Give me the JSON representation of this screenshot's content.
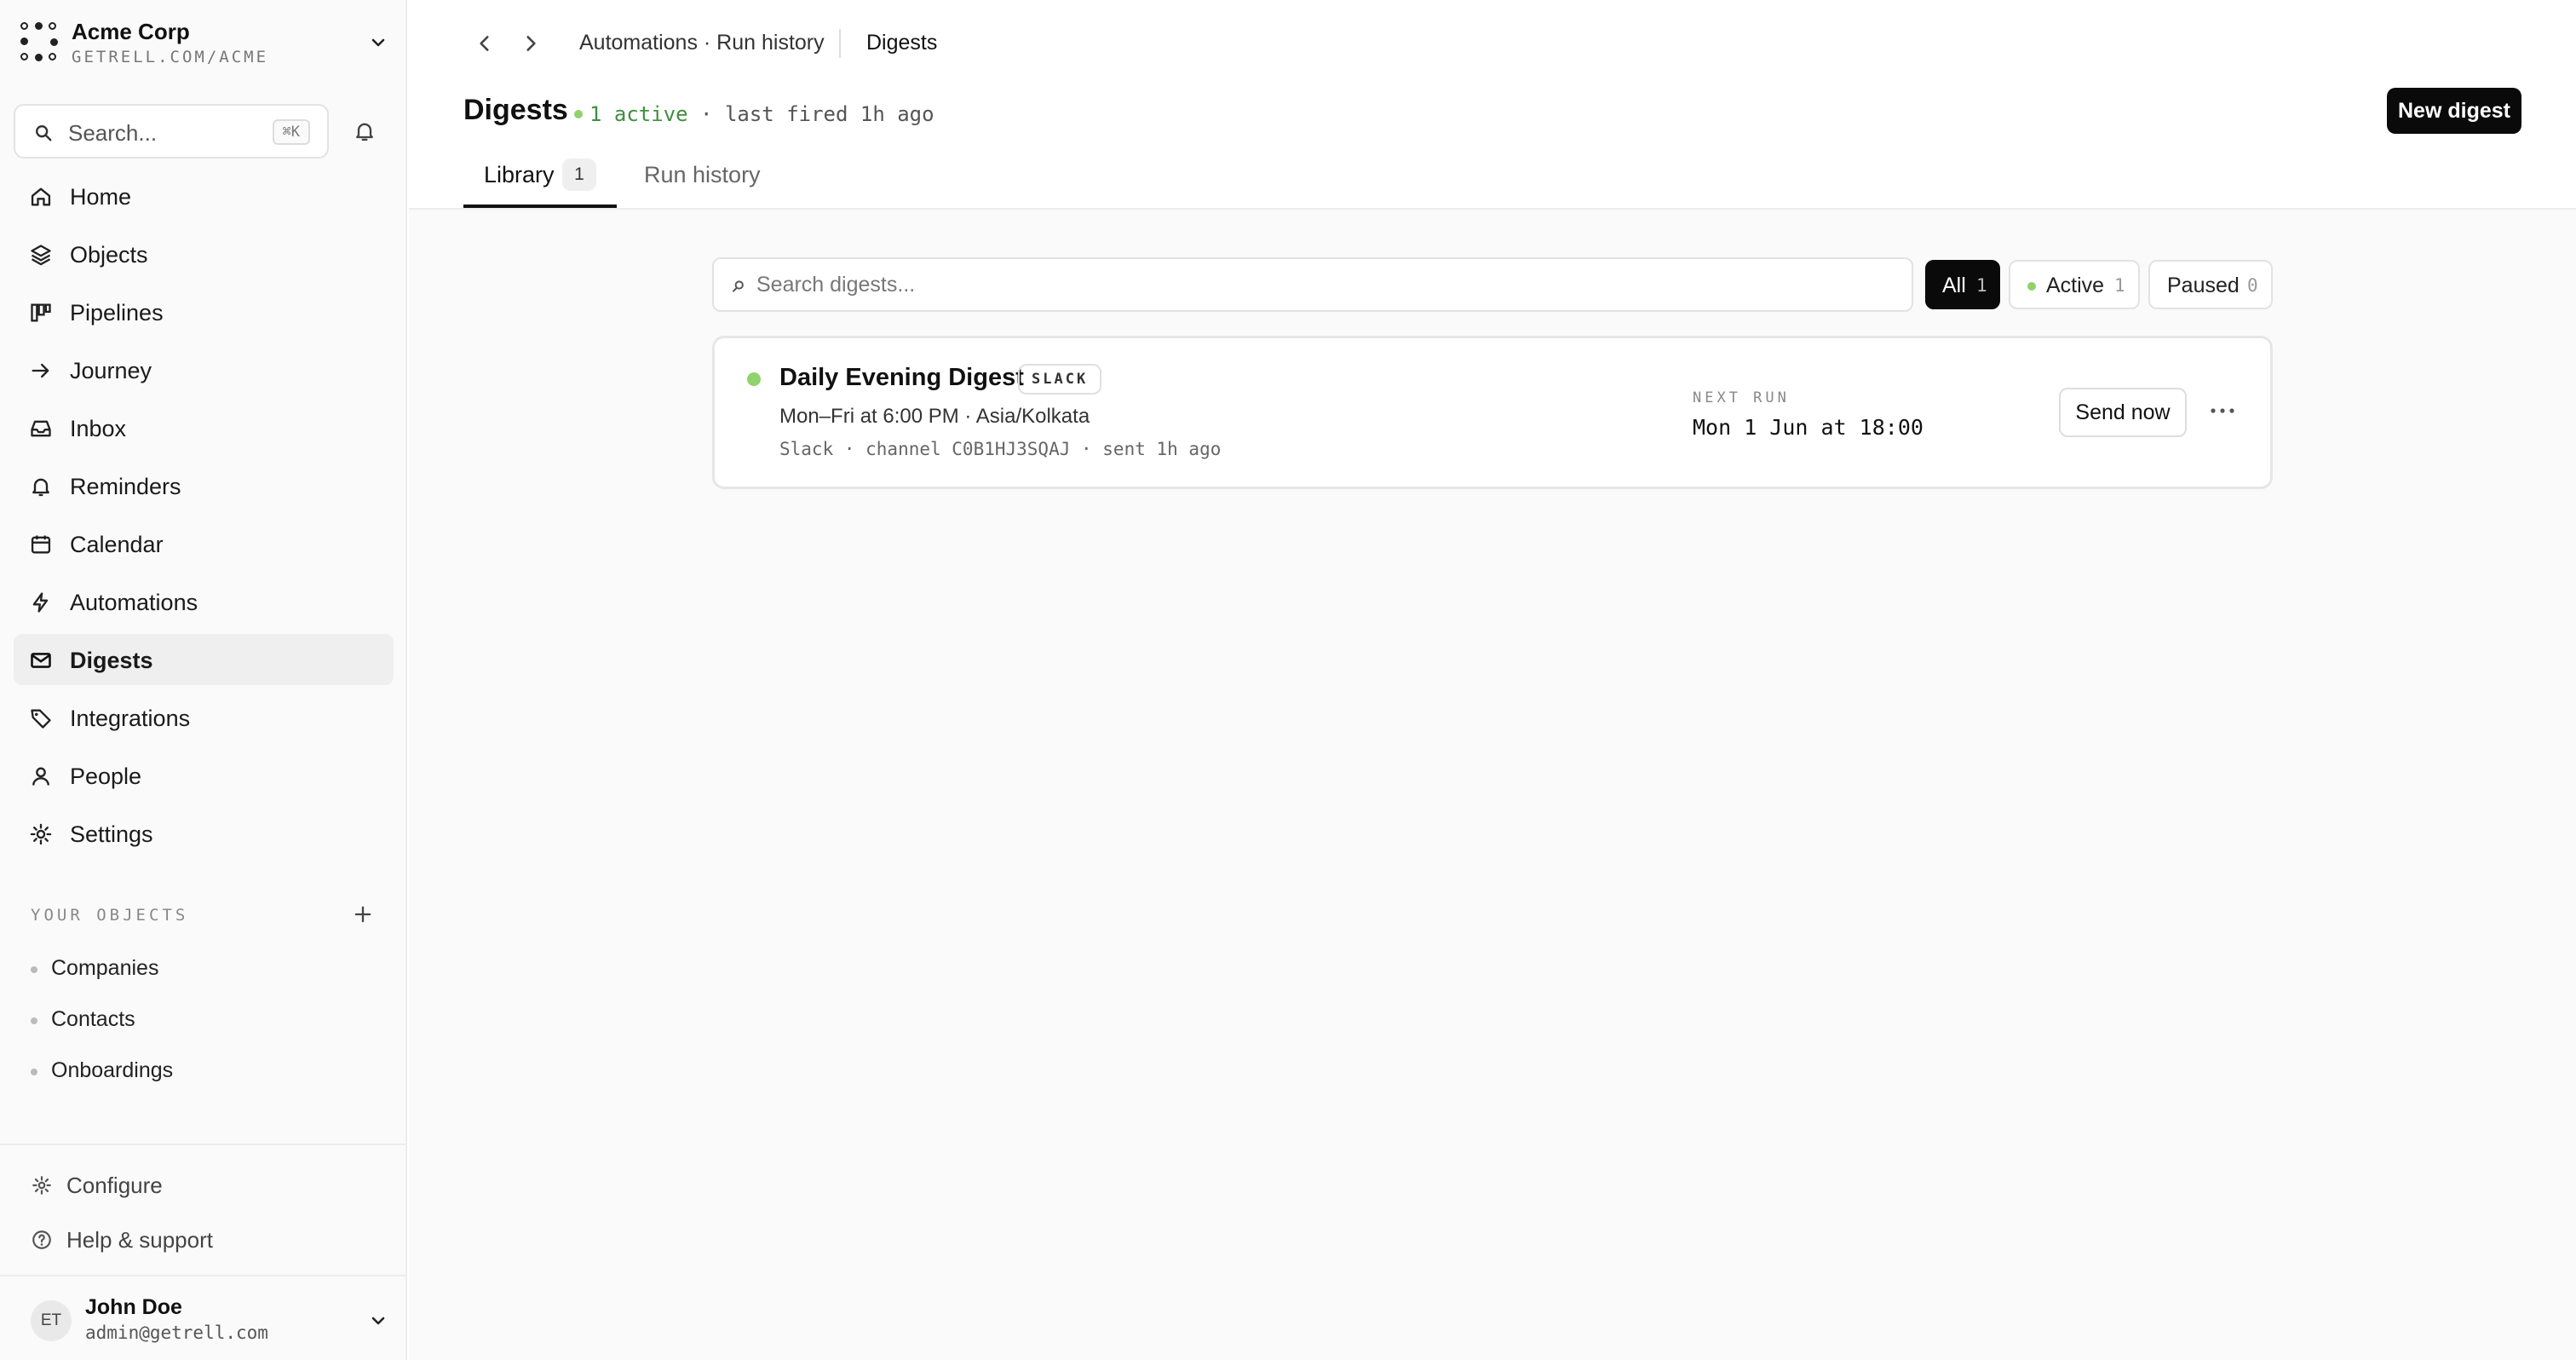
{
  "org": {
    "name": "Acme Corp",
    "url": "GETRELL.COM/ACME"
  },
  "search": {
    "placeholder": "Search...",
    "shortcut": "⌘K"
  },
  "nav": {
    "items": [
      {
        "label": "Home",
        "icon": "home-icon"
      },
      {
        "label": "Objects",
        "icon": "layers-icon"
      },
      {
        "label": "Pipelines",
        "icon": "kanban-icon"
      },
      {
        "label": "Journey",
        "icon": "arrow-right-icon"
      },
      {
        "label": "Inbox",
        "icon": "inbox-icon"
      },
      {
        "label": "Reminders",
        "icon": "bell-icon"
      },
      {
        "label": "Calendar",
        "icon": "calendar-icon"
      },
      {
        "label": "Automations",
        "icon": "bolt-icon"
      },
      {
        "label": "Digests",
        "icon": "mail-icon",
        "active": true
      },
      {
        "label": "Integrations",
        "icon": "tag-icon"
      },
      {
        "label": "People",
        "icon": "person-icon"
      },
      {
        "label": "Settings",
        "icon": "gear-icon"
      }
    ]
  },
  "your_objects": {
    "heading": "YOUR OBJECTS",
    "items": [
      "Companies",
      "Contacts",
      "Onboardings"
    ]
  },
  "footer": {
    "configure": "Configure",
    "help": "Help & support"
  },
  "user": {
    "initials": "ET",
    "name": "John Doe",
    "email": "admin@getrell.com"
  },
  "breadcrumb": {
    "parent": "Automations · Run history",
    "current": "Digests"
  },
  "page": {
    "title": "Digests",
    "status_active": "1 active",
    "status_rest": "· last fired 1h ago",
    "new_button": "New digest"
  },
  "tabs": [
    {
      "label": "Library",
      "count": "1",
      "active": true
    },
    {
      "label": "Run history"
    }
  ],
  "filter": {
    "placeholder": "Search digests...",
    "chips": [
      {
        "label": "All",
        "count": "1",
        "selected": true
      },
      {
        "label": "Active",
        "count": "1"
      },
      {
        "label": "Paused",
        "count": "0"
      }
    ]
  },
  "digest": {
    "name": "Daily Evening Digest",
    "tag": "SLACK",
    "schedule": "Mon–Fri at 6:00 PM · Asia/Kolkata",
    "meta": "Slack · channel C0B1HJ3SQAJ · sent 1h ago",
    "next_run_label": "NEXT RUN",
    "next_run_value": "Mon 1 Jun at 18:00",
    "send_button": "Send now",
    "more": "···"
  },
  "colors": {
    "accent_green": "#8fd36a",
    "primary_button": "#0a0a0a"
  }
}
